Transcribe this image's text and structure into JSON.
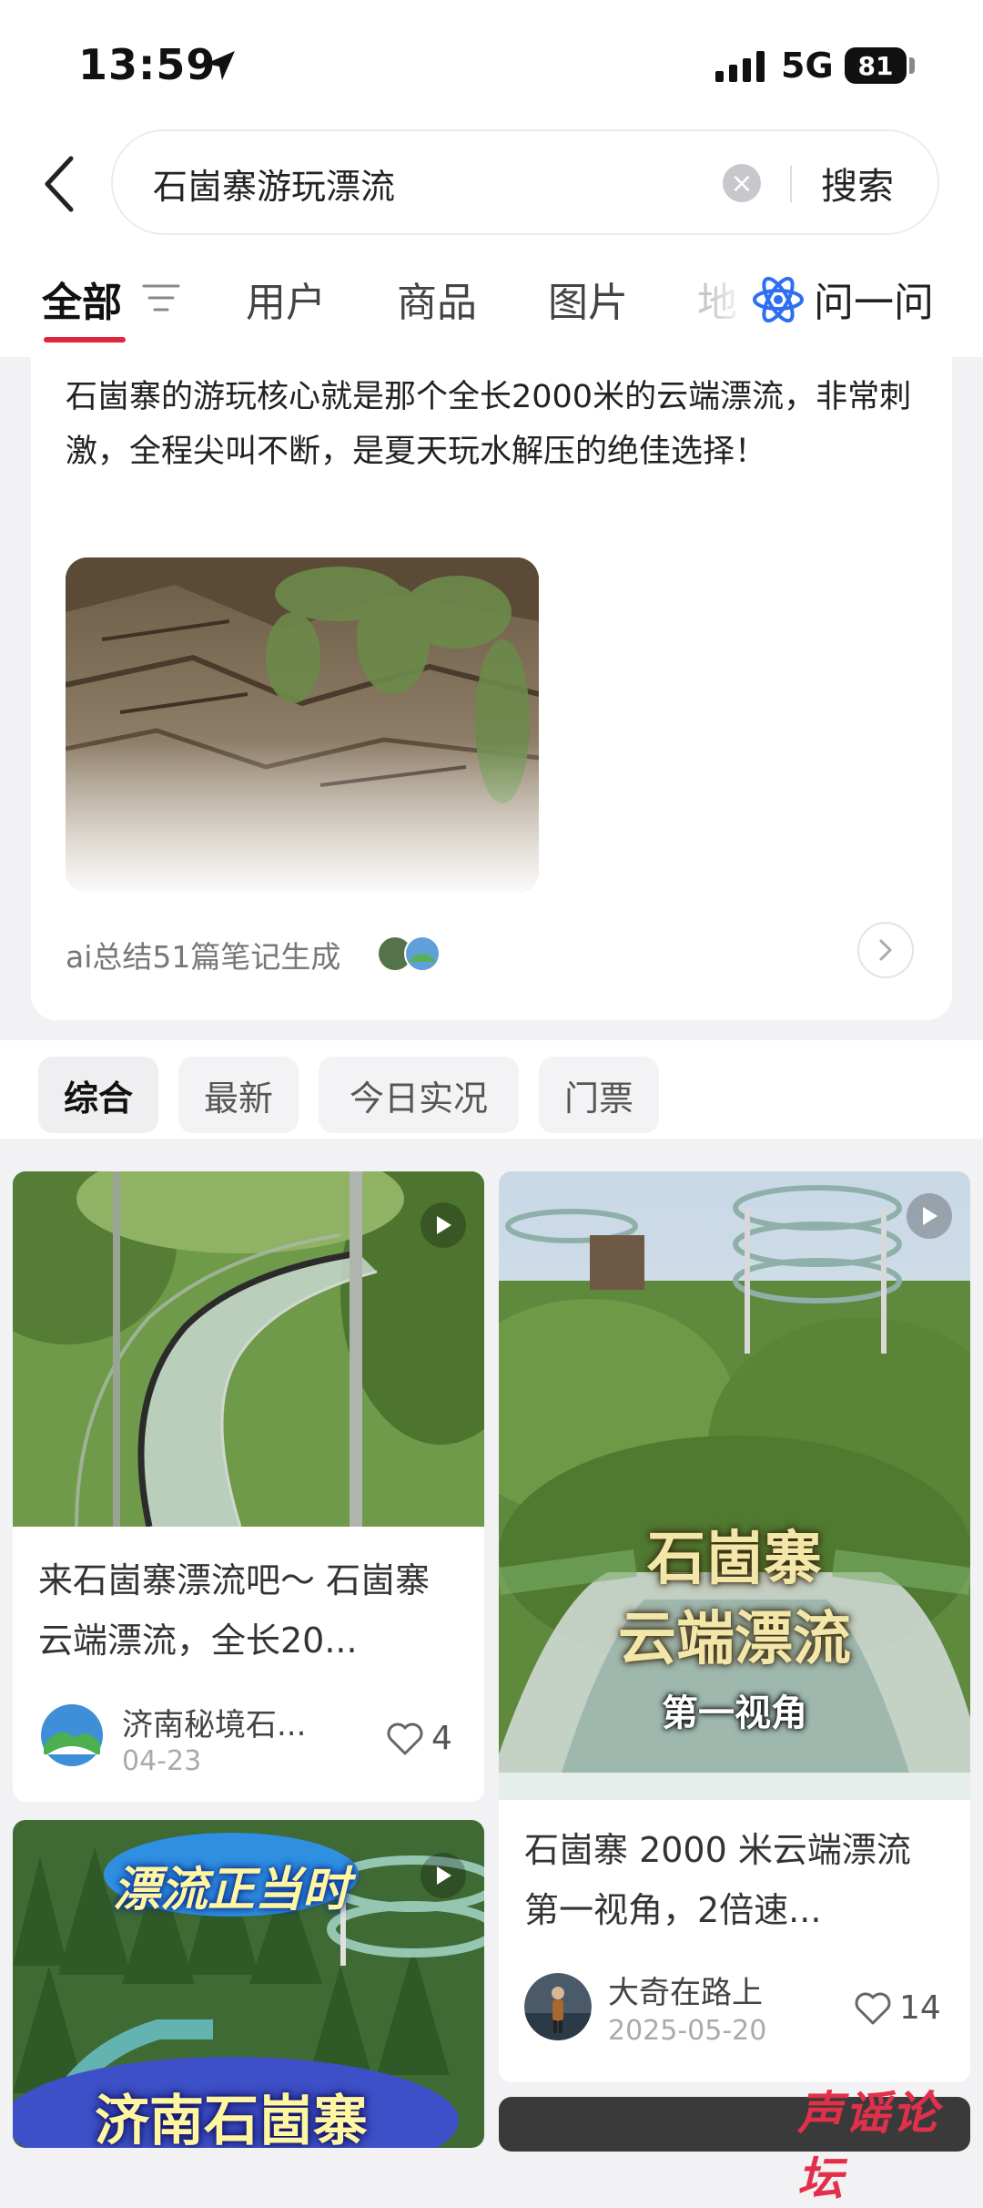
{
  "status_bar": {
    "time": "13:59",
    "network": "5G",
    "battery": "81"
  },
  "search": {
    "query": "石崮寨游玩漂流",
    "button": "搜索"
  },
  "tabs": {
    "items": [
      "全部",
      "用户",
      "商品",
      "图片"
    ],
    "partial": "地",
    "ask": "问一问"
  },
  "ai_summary": {
    "text": "石崮寨的游玩核心就是那个全长2000米的云端漂流，非常刺激，全程尖叫不断，是夏天玩水解压的绝佳选择！",
    "source": "ai总结51篇笔记生成"
  },
  "filters": [
    "综合",
    "最新",
    "今日实况",
    "门票"
  ],
  "posts": [
    {
      "title": "来石崮寨漂流吧～ 石崮寨云端漂流，全长20...",
      "author": "济南秘境石...",
      "date": "04-23",
      "likes": "4"
    },
    {
      "title": "石崮寨 2000 米云端漂流第一视角，2倍速...",
      "author": "大奇在路上",
      "date": "2025-05-20",
      "likes": "14",
      "overlay_line1": "石崮寨",
      "overlay_line2": "云端漂流",
      "overlay_line3": "第一视角"
    },
    {
      "overlay_line1": "漂流正当时",
      "overlay_line2": "济南石崮寨"
    }
  ],
  "watermark": "声谣论坛",
  "colors": {
    "accent": "#e0263f",
    "ask_icon": "#2e6ff2",
    "background": "#f2f2f4"
  }
}
